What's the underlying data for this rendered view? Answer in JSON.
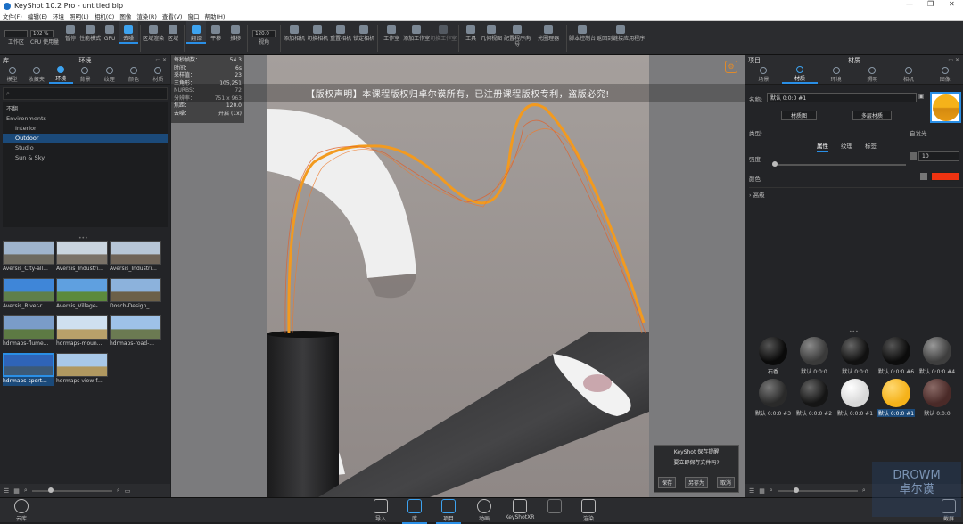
{
  "window": {
    "title": "KeyShot 10.2 Pro  -  untitled.bip",
    "controls": [
      "—",
      "❐",
      "✕"
    ]
  },
  "menu": [
    "文件(F)",
    "编辑(E)",
    "环境",
    "照明(L)",
    "相机(C)",
    "图像",
    "渲染(R)",
    "查看(V)",
    "窗口",
    "帮助(H)"
  ],
  "toolbar": {
    "left_fields": [
      "",
      "102  %"
    ],
    "items": [
      "工作区",
      "CPU 使用量",
      "暂停",
      "性能模式",
      "GPU",
      "去噪",
      "区域渲染",
      "区域",
      "翻译",
      "平移",
      "推移",
      "视角",
      "添加相机",
      "切换相机",
      "重置相机",
      "锁定相机",
      "工作室",
      "添加工作室",
      "切换工作室",
      "工具",
      "几何视图",
      "配置程序向导",
      "光圈理器",
      "脚本控制台",
      "返回到链接应用程序"
    ],
    "zoom_field": "120.0",
    "active": "去噪"
  },
  "library": {
    "panel_left_label": "库",
    "title": "环境",
    "tabs": [
      "模型",
      "收藏夹",
      "环境",
      "背景",
      "纹理",
      "颜色",
      "材质"
    ],
    "active_tab": "环境",
    "search_placeholder": "",
    "tree": [
      "不翻",
      "Environments",
      "Interior",
      "Outdoor",
      "Studio",
      "Sun & Sky"
    ],
    "tree_selected": "Outdoor",
    "thumbs": [
      {
        "label": "Aversis_City-all...",
        "c1": "#9fb4cc",
        "c2": "#6d6a60"
      },
      {
        "label": "Aversis_Industri...",
        "c1": "#c9d4de",
        "c2": "#7a7268"
      },
      {
        "label": "Aversis_Industri...",
        "c1": "#b7c6d6",
        "c2": "#6f6458"
      },
      {
        "label": "Aversis_River-r...",
        "c1": "#3f86d8",
        "c2": "#5f7f4a"
      },
      {
        "label": "Aversis_Village-...",
        "c1": "#5fa0e0",
        "c2": "#5c8a3c"
      },
      {
        "label": "Dosch-Design_...",
        "c1": "#8cb2dc",
        "c2": "#6c6048"
      },
      {
        "label": "hdrmaps-flume...",
        "c1": "#7a9cc8",
        "c2": "#5d7a44"
      },
      {
        "label": "hdrmaps-moun...",
        "c1": "#cfe0f0",
        "c2": "#b8a06a"
      },
      {
        "label": "hdrmaps-road-...",
        "c1": "#9ec2e8",
        "c2": "#6b7a52"
      },
      {
        "label": "hdrmaps-sport...",
        "c1": "#2f64b8",
        "c2": "#3c5a78"
      },
      {
        "label": "hdrmaps-view-f...",
        "c1": "#a8c8e8",
        "c2": "#b09860"
      }
    ],
    "thumb_selected": 9
  },
  "hud": [
    [
      "每秒帧数：",
      "54.3"
    ],
    [
      "时间：",
      "6s"
    ],
    [
      "采样值：",
      "23"
    ],
    [
      "三角形：",
      "105,251"
    ],
    [
      "NURBS：",
      "72"
    ],
    [
      "分辨率：",
      "751 x 963"
    ],
    [
      "焦距：",
      "120.0"
    ],
    [
      "去噪：",
      "开启  (1x)"
    ]
  ],
  "banner": "【版权声明】本课程版权归卓尔谟所有，已注册课程版权专利，盗版必究!",
  "dialog": {
    "title": "KeyShot 保存提醒",
    "text": "要立即保存文件吗?",
    "buttons": [
      "保存",
      "另存为",
      "取消"
    ]
  },
  "project": {
    "panel_left_label": "项目",
    "title": "材质",
    "tabs": [
      "场景",
      "材质",
      "环境",
      "照明",
      "相机",
      "图像"
    ],
    "active_tab": "材质",
    "name_label": "名称:",
    "name_value": "默认 0:0:0 #1",
    "buttons": [
      "材质图",
      "多层材质"
    ],
    "type_label": "类型:",
    "type_value": "自发光",
    "subtabs": [
      "属性",
      "纹理",
      "标签"
    ],
    "active_subtab": "属性",
    "props": [
      {
        "label": "强度",
        "value": "10"
      },
      {
        "label": "颜色",
        "value": ""
      }
    ],
    "advanced_label": "高级",
    "color_swatch": "#ee3311",
    "materials": [
      {
        "label": "石香",
        "color": "#0a0a0a",
        "hi": "#555"
      },
      {
        "label": "默认 0:0:0",
        "color": "#3a3a3a",
        "hi": "#8a8a8a"
      },
      {
        "label": "默认 0:0:0",
        "color": "#111",
        "hi": "#666"
      },
      {
        "label": "默认 0:0:0 #6",
        "color": "#0c0c0c",
        "hi": "#555"
      },
      {
        "label": "默认 0:0:0 #4",
        "color": "#3e3e3e",
        "hi": "#999"
      },
      {
        "label": "默认 0:0:0 #3",
        "color": "#2a2a2a",
        "hi": "#777"
      },
      {
        "label": "默认 0:0:0 #2",
        "color": "#151515",
        "hi": "#666"
      },
      {
        "label": "默认 0:0:0 #1",
        "color": "#d8d8d8",
        "hi": "#fff"
      },
      {
        "label": "默认 0:0:0 #1",
        "color": "#f5b21a",
        "hi": "#ffd870"
      },
      {
        "label": "默认 0:0:0",
        "color": "#4a2a28",
        "hi": "#8a6a66"
      }
    ],
    "material_selected": 8
  },
  "bottom": {
    "left_label": "云库",
    "items": [
      "导入",
      "库",
      "项目",
      "动画",
      "KeyShotXR",
      "",
      "渲染"
    ],
    "active": [
      "库",
      "项目"
    ],
    "right_label": "截屏"
  },
  "watermark": [
    "DROWM",
    "卓尔谟"
  ]
}
